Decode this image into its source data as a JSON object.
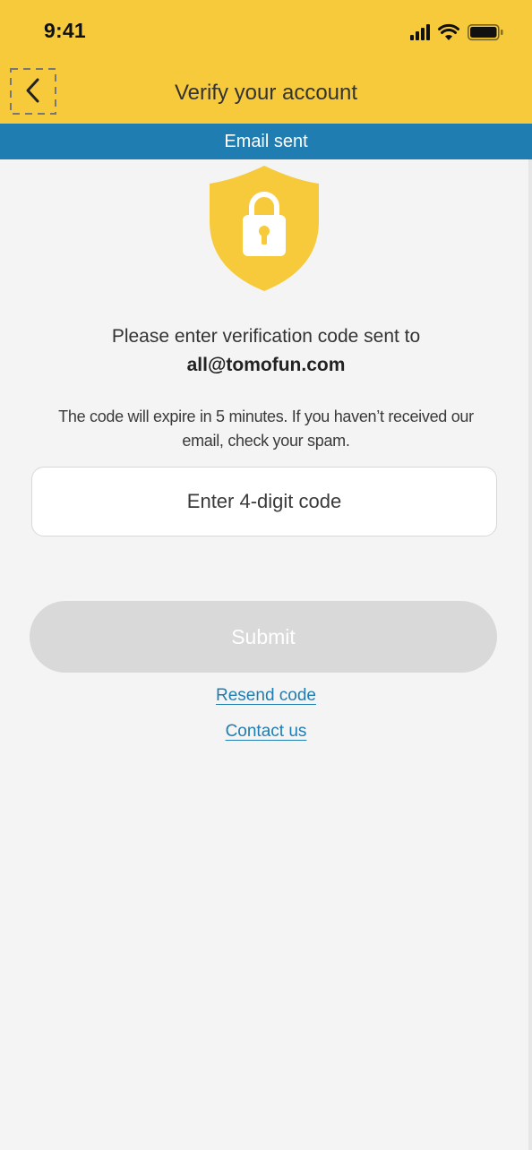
{
  "status_bar": {
    "time": "9:41",
    "icons": [
      "signal-icon",
      "wifi-icon",
      "battery-icon"
    ]
  },
  "header": {
    "title": "Verify your account",
    "back_icon": "chevron-left-icon",
    "background_color": "#f7ca3b"
  },
  "banner": {
    "text": "Email sent",
    "background_color": "#1f7db2"
  },
  "shield": {
    "icon": "shield-lock-icon",
    "color": "#f7ca3b"
  },
  "instruction": {
    "text": "Please enter verification code sent to",
    "email": "all@tomofun.com"
  },
  "note": {
    "line1": "The code will expire in 5 minutes.  If you haven’t received our",
    "line2": "email, check your spam."
  },
  "code_input": {
    "value": "",
    "placeholder": "Enter 4-digit code"
  },
  "submit": {
    "label": "Submit",
    "disabled_color": "#d9d9d9"
  },
  "links": {
    "resend": "Resend code",
    "contact": "Contact us",
    "color": "#1f7db2"
  }
}
